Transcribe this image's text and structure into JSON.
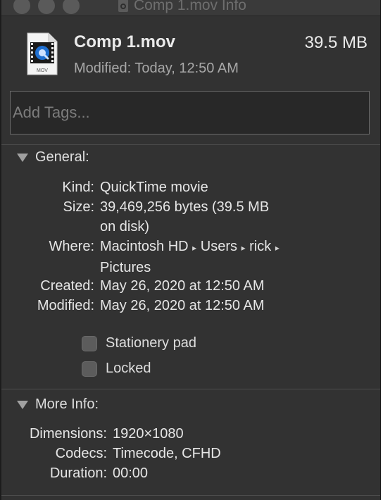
{
  "window": {
    "title": "Comp 1.mov Info"
  },
  "header": {
    "file_name": "Comp 1.mov",
    "file_size": "39.5 MB",
    "modified_label": "Modified:",
    "modified_value": "Today, 12:50 AM",
    "file_icon": "quicktime-mov-icon",
    "file_icon_badge": "MOV"
  },
  "tags": {
    "placeholder": "Add Tags..."
  },
  "general": {
    "title": "General:",
    "rows": [
      {
        "label": "Kind:",
        "value": "QuickTime movie"
      },
      {
        "label": "Size:",
        "value": "39,469,256 bytes (39.5 MB\non disk)"
      },
      {
        "label": "Where:",
        "path": [
          "Macintosh HD",
          "Users",
          "rick",
          "Pictures"
        ],
        "separator": "▸"
      },
      {
        "label": "Created:",
        "value": "May 26, 2020 at 12:50 AM"
      },
      {
        "label": "Modified:",
        "value": "May 26, 2020 at 12:50 AM"
      }
    ],
    "stationery_pad": {
      "label": "Stationery pad",
      "checked": false
    },
    "locked": {
      "label": "Locked",
      "checked": false
    }
  },
  "more_info": {
    "title": "More Info:",
    "rows": [
      {
        "label": "Dimensions:",
        "value": "1920×1080"
      },
      {
        "label": "Codecs:",
        "value": "Timecode, CFHD"
      },
      {
        "label": "Duration:",
        "value": "00:00"
      }
    ]
  },
  "colors": {
    "window_bg": "#323232",
    "text_primary": "#e6e6e6",
    "text_secondary": "#a8a8a8",
    "quicktime_blue": "#1f6fd0"
  }
}
